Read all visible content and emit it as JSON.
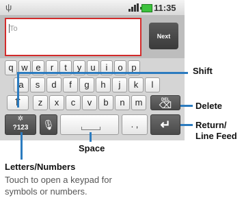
{
  "status_bar": {
    "time": "11:35",
    "usb_icon": "usb-icon",
    "signal_icon": "signal-icon",
    "battery_icon": "battery-icon"
  },
  "compose": {
    "to_placeholder": "To",
    "next_label": "Next"
  },
  "keyboard": {
    "row1": [
      "q",
      "w",
      "e",
      "r",
      "t",
      "y",
      "u",
      "i",
      "o",
      "p"
    ],
    "row2": [
      "a",
      "s",
      "d",
      "f",
      "g",
      "h",
      "j",
      "k",
      "l"
    ],
    "row3": [
      "z",
      "x",
      "c",
      "v",
      "b",
      "n",
      "m"
    ],
    "symbols_label": "?123",
    "delete_label": "DEL",
    "punct_label": ". ,"
  },
  "callouts": {
    "shift": "Shift",
    "delete": "Delete",
    "return_line1": "Return/",
    "return_line2": "Line Feed",
    "space": "Space",
    "letters_numbers": "Letters/Numbers"
  },
  "hint": {
    "line1": "Touch to open a keypad for",
    "line2": "symbols or numbers."
  },
  "colors": {
    "accent_line": "#2b7bbf",
    "to_border": "#d22b2b"
  }
}
